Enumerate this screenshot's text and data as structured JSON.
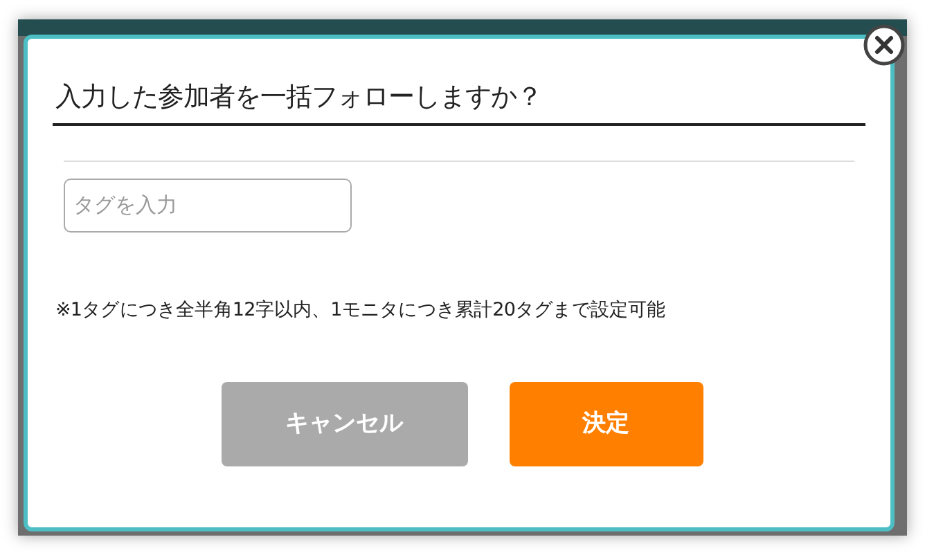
{
  "dialog": {
    "title": "入力した参加者を一括フォローしますか？",
    "tag_field": {
      "placeholder": "タグを入力"
    },
    "note": "※1タグにつき全半角12字以内、1モニタにつき累計20タグまで設定可能",
    "buttons": [
      {
        "label": "キャンセル",
        "kind": "cancel"
      },
      {
        "label": "決定",
        "kind": "confirm"
      }
    ]
  }
}
